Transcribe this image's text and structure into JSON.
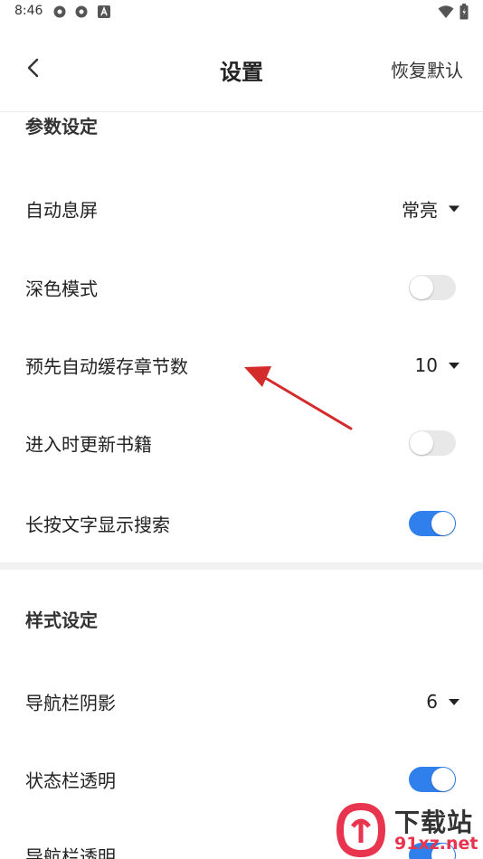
{
  "status_bar": {
    "time": "8:46"
  },
  "app_bar": {
    "title": "设置",
    "restore_label": "恢复默认"
  },
  "params_section": {
    "title": "参数设定",
    "rows": [
      {
        "label": "自动息屏",
        "value": "常亮",
        "control": "dropdown"
      },
      {
        "label": "深色模式",
        "control": "toggle",
        "on": false
      },
      {
        "label": "预先自动缓存章节数",
        "value": "10",
        "control": "dropdown"
      },
      {
        "label": "进入时更新书籍",
        "control": "toggle",
        "on": false
      },
      {
        "label": "长按文字显示搜索",
        "control": "toggle",
        "on": true
      }
    ]
  },
  "style_section": {
    "title": "样式设定",
    "rows": [
      {
        "label": "导航栏阴影",
        "value": "6",
        "control": "dropdown"
      },
      {
        "label": "状态栏透明",
        "control": "toggle",
        "on": true
      },
      {
        "label": "导航栏透明",
        "control": "toggle",
        "on": true
      }
    ]
  },
  "watermark": {
    "brand": "下载站",
    "site": "91xz.net"
  },
  "colors": {
    "accent": "#2f80ed",
    "toggle_off": "#e8e8e8",
    "annotation": "#d42b2b",
    "watermark": "#e8344e"
  }
}
